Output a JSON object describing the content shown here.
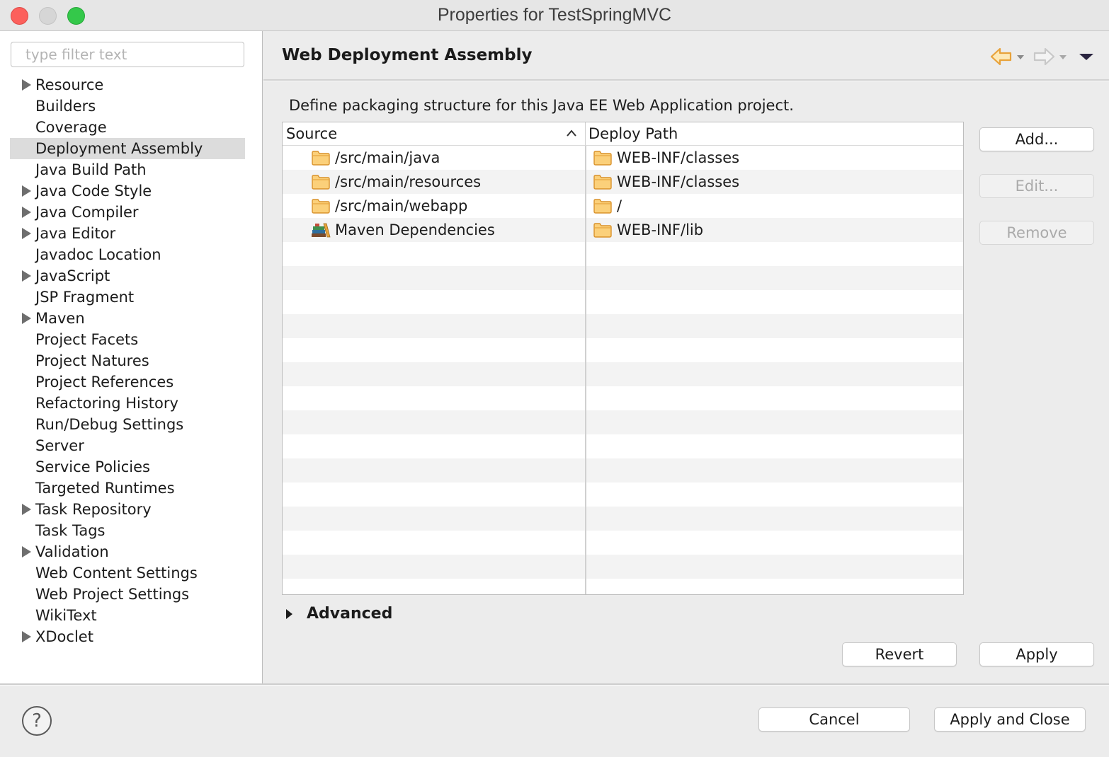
{
  "window": {
    "title": "Properties for TestSpringMVC"
  },
  "sidebar": {
    "filter_placeholder": "type filter text",
    "items": [
      {
        "label": "Resource",
        "expandable": true
      },
      {
        "label": "Builders",
        "expandable": false
      },
      {
        "label": "Coverage",
        "expandable": false
      },
      {
        "label": "Deployment Assembly",
        "expandable": false,
        "selected": true
      },
      {
        "label": "Java Build Path",
        "expandable": false
      },
      {
        "label": "Java Code Style",
        "expandable": true
      },
      {
        "label": "Java Compiler",
        "expandable": true
      },
      {
        "label": "Java Editor",
        "expandable": true
      },
      {
        "label": "Javadoc Location",
        "expandable": false
      },
      {
        "label": "JavaScript",
        "expandable": true
      },
      {
        "label": "JSP Fragment",
        "expandable": false
      },
      {
        "label": "Maven",
        "expandable": true
      },
      {
        "label": "Project Facets",
        "expandable": false
      },
      {
        "label": "Project Natures",
        "expandable": false
      },
      {
        "label": "Project References",
        "expandable": false
      },
      {
        "label": "Refactoring History",
        "expandable": false
      },
      {
        "label": "Run/Debug Settings",
        "expandable": false
      },
      {
        "label": "Server",
        "expandable": false
      },
      {
        "label": "Service Policies",
        "expandable": false
      },
      {
        "label": "Targeted Runtimes",
        "expandable": false
      },
      {
        "label": "Task Repository",
        "expandable": true
      },
      {
        "label": "Task Tags",
        "expandable": false
      },
      {
        "label": "Validation",
        "expandable": true
      },
      {
        "label": "Web Content Settings",
        "expandable": false
      },
      {
        "label": "Web Project Settings",
        "expandable": false
      },
      {
        "label": "WikiText",
        "expandable": false
      },
      {
        "label": "XDoclet",
        "expandable": true
      }
    ]
  },
  "page": {
    "title": "Web Deployment Assembly",
    "description": "Define packaging structure for this Java EE Web Application project.",
    "table": {
      "columns": {
        "source": "Source",
        "deploy_path": "Deploy Path"
      },
      "sorted_column": "source",
      "rows": [
        {
          "source": "/src/main/java",
          "source_icon": "folder-icon",
          "deploy_path": "WEB-INF/classes",
          "deploy_icon": "folder-icon"
        },
        {
          "source": "/src/main/resources",
          "source_icon": "folder-icon",
          "deploy_path": "WEB-INF/classes",
          "deploy_icon": "folder-icon"
        },
        {
          "source": "/src/main/webapp",
          "source_icon": "folder-icon",
          "deploy_path": "/",
          "deploy_icon": "folder-icon"
        },
        {
          "source": "Maven Dependencies",
          "source_icon": "library-icon",
          "deploy_path": "WEB-INF/lib",
          "deploy_icon": "folder-icon"
        }
      ]
    },
    "buttons": {
      "add": "Add...",
      "edit": "Edit...",
      "remove": "Remove",
      "revert": "Revert",
      "apply": "Apply"
    },
    "advanced": {
      "label": "Advanced",
      "expanded": false
    }
  },
  "footer": {
    "cancel": "Cancel",
    "apply_and_close": "Apply and Close",
    "help_icon": "question-mark-icon"
  },
  "colors": {
    "selection": "#dcdcdc",
    "close": "#fc605c",
    "maximize": "#34c84a",
    "back_arrow": "#e8a23a"
  }
}
